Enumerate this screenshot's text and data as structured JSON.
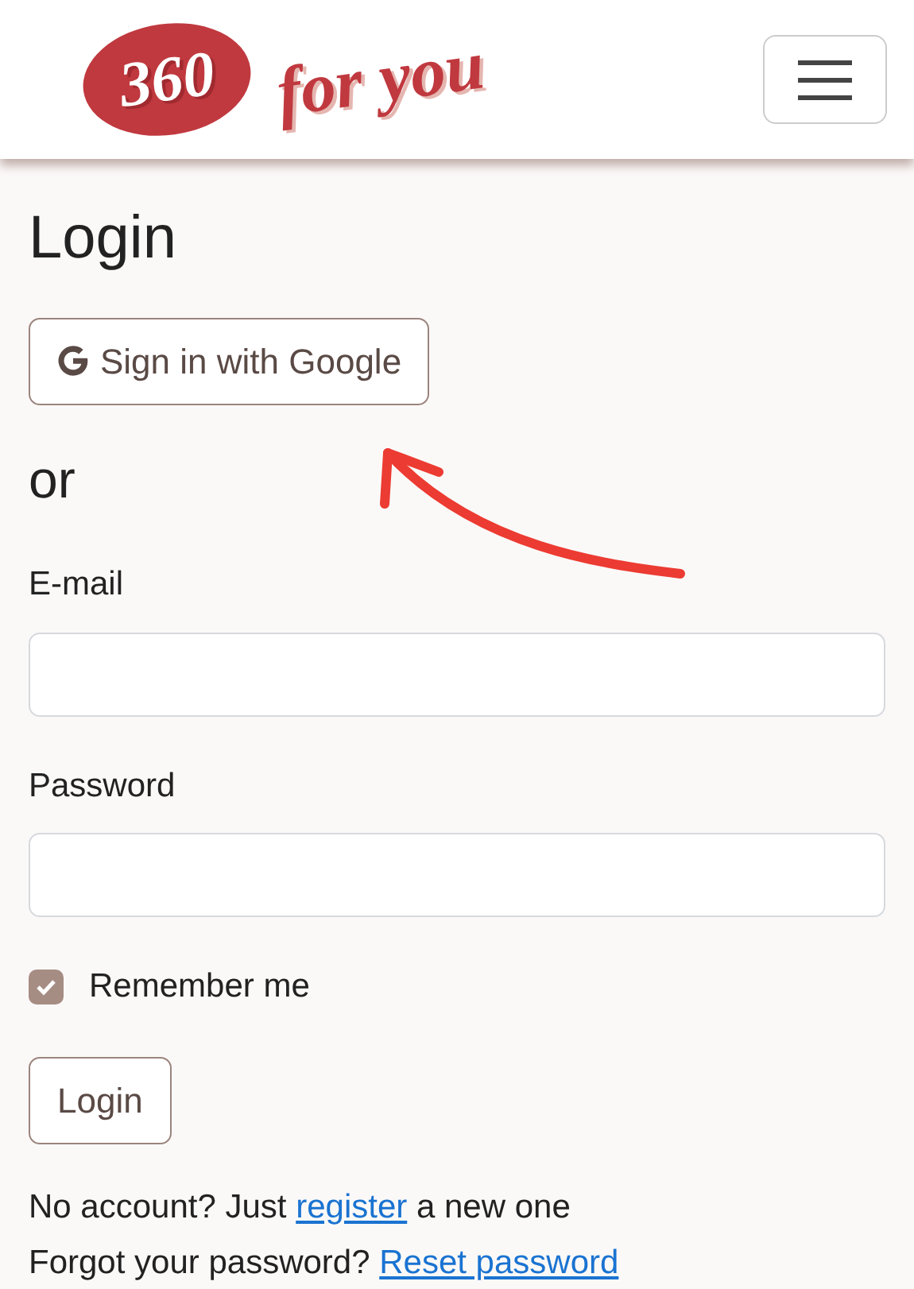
{
  "navbar": {
    "logo": {
      "number": "360",
      "tagline": "for you"
    },
    "menu_expanded": false
  },
  "heading": "Login",
  "google_button": {
    "label": "Sign in with Google"
  },
  "separator": "or",
  "fields": [
    {
      "label": "E-mail"
    },
    {
      "label": "Password"
    }
  ],
  "remember": {
    "label": "Remember me",
    "checked": true
  },
  "submit": {
    "label": "Login"
  },
  "links": [
    {
      "before": "No account? Just ",
      "link": "register",
      "after": " a new one"
    },
    {
      "before": "Forgot your password? ",
      "link": "Reset password"
    }
  ]
}
